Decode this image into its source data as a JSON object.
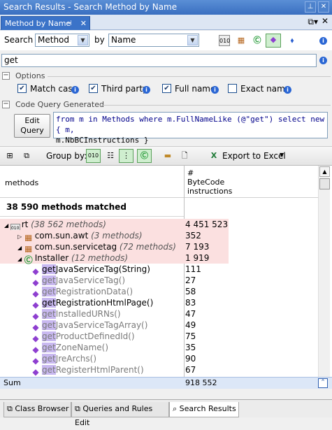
{
  "window": {
    "title": "Search Results - Search Method by Name"
  },
  "tab": {
    "label": "Method by Name"
  },
  "search": {
    "search_label": "Search",
    "search_value": "Method",
    "by_label": "by",
    "by_value": "Name",
    "query_text": "get"
  },
  "options": {
    "section_label": "Options",
    "checks": [
      {
        "label": "Match case",
        "checked": true
      },
      {
        "label": "Third party",
        "checked": true
      },
      {
        "label": "Full name",
        "checked": true
      },
      {
        "label": "Exact name",
        "checked": false
      }
    ]
  },
  "code_query": {
    "section_label": "Code Query Generated",
    "edit_button": "Edit Query",
    "line1": "from m in Methods where m.FullNameLike (@\"get\") select new { m,",
    "line2": "m.NbBCInstructions }"
  },
  "toolbar": {
    "group_by_label": "Group by:",
    "export_label": "Export to Excel"
  },
  "grid": {
    "col_methods": "methods",
    "col_bytecode": "# ByteCode instructions",
    "matched": "38 590 methods matched",
    "rows": [
      {
        "name": "rt",
        "note": "(38 562 methods)",
        "value": "4 451 523",
        "indent": 0,
        "kind": "assembly",
        "hl": true,
        "dim": false
      },
      {
        "name": "com.sun.awt",
        "note": "(3 methods)",
        "value": "352",
        "indent": 1,
        "kind": "namespace",
        "hl": true,
        "dim": false
      },
      {
        "name": "com.sun.servicetag",
        "note": "(72 methods)",
        "value": "7 193",
        "indent": 1,
        "kind": "namespace",
        "hl": true,
        "dim": false
      },
      {
        "name": "Installer",
        "note": "(12 methods)",
        "value": "1 919",
        "indent": 2,
        "kind": "class",
        "hl": true,
        "dim": false
      },
      {
        "name": "getJavaServiceTag(String)",
        "note": "",
        "value": "111",
        "indent": 3,
        "kind": "method",
        "hl": false,
        "dim": false
      },
      {
        "name": "getJavaServiceTag()",
        "note": "",
        "value": "27",
        "indent": 3,
        "kind": "method",
        "hl": false,
        "dim": true
      },
      {
        "name": "getRegistrationData()",
        "note": "",
        "value": "58",
        "indent": 3,
        "kind": "method",
        "hl": false,
        "dim": true
      },
      {
        "name": "getRegistrationHtmlPage()",
        "note": "",
        "value": "83",
        "indent": 3,
        "kind": "method",
        "hl": false,
        "dim": false
      },
      {
        "name": "getInstalledURNs()",
        "note": "",
        "value": "47",
        "indent": 3,
        "kind": "method",
        "hl": false,
        "dim": true
      },
      {
        "name": "getJavaServiceTagArray()",
        "note": "",
        "value": "49",
        "indent": 3,
        "kind": "method",
        "hl": false,
        "dim": true
      },
      {
        "name": "getProductDefinedId()",
        "note": "",
        "value": "75",
        "indent": 3,
        "kind": "method",
        "hl": false,
        "dim": true
      },
      {
        "name": "getZoneName()",
        "note": "",
        "value": "35",
        "indent": 3,
        "kind": "method",
        "hl": false,
        "dim": true
      },
      {
        "name": "getJreArchs()",
        "note": "",
        "value": "90",
        "indent": 3,
        "kind": "method",
        "hl": false,
        "dim": true
      },
      {
        "name": "getRegisterHtmlParent()",
        "note": "",
        "value": "67",
        "indent": 3,
        "kind": "method",
        "hl": false,
        "dim": true
      }
    ]
  },
  "sum": {
    "label": "Sum",
    "value": "918 552"
  },
  "bottom_tabs": [
    {
      "label": "Class Browser",
      "active": false
    },
    {
      "label": "Queries and Rules Edit",
      "active": false
    },
    {
      "label": "Search Results",
      "active": true
    }
  ],
  "colors": {
    "accent": "#3b73c8",
    "highlight_row": "#fbe0e0",
    "sum_bar": "#dce7f7"
  }
}
